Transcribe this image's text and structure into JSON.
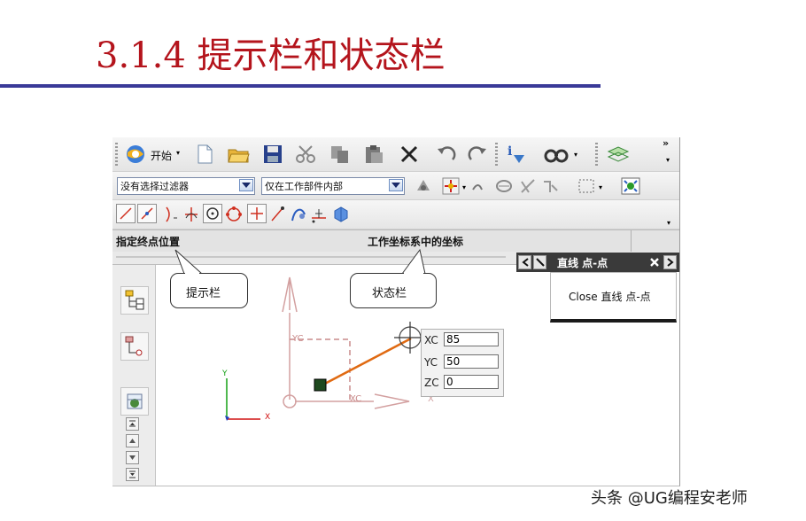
{
  "slide": {
    "title": "3.1.4  提示栏和状态栏",
    "watermark": "头条 @UG编程安老师"
  },
  "toolbar1": {
    "start_label": "开始",
    "overflow": "»"
  },
  "toolbar2": {
    "filter_value": "没有选择过滤器",
    "scope_value": "仅在工作部件内部"
  },
  "cue_line": {
    "cue_text": "指定终点位置",
    "status_text": "工作坐标系中的坐标"
  },
  "dialog": {
    "heading": "直线 点-点",
    "close_label": "Close 直线 点-点"
  },
  "coordinates": [
    {
      "label": "XC",
      "value": "85"
    },
    {
      "label": "YC",
      "value": "50"
    },
    {
      "label": "ZC",
      "value": "0"
    }
  ],
  "sketch_labels": {
    "yc": "YC",
    "xc": "XC",
    "x_ghost": "X",
    "wcs_y": "Y",
    "wcs_x": "X"
  },
  "callouts": {
    "cue": "提示栏",
    "status": "状态栏"
  },
  "colors": {
    "title_red": "#b4141c",
    "rule_blue": "#3a3a98",
    "line_orange": "#e06a12",
    "dashed_pink": "#c98a8a"
  }
}
